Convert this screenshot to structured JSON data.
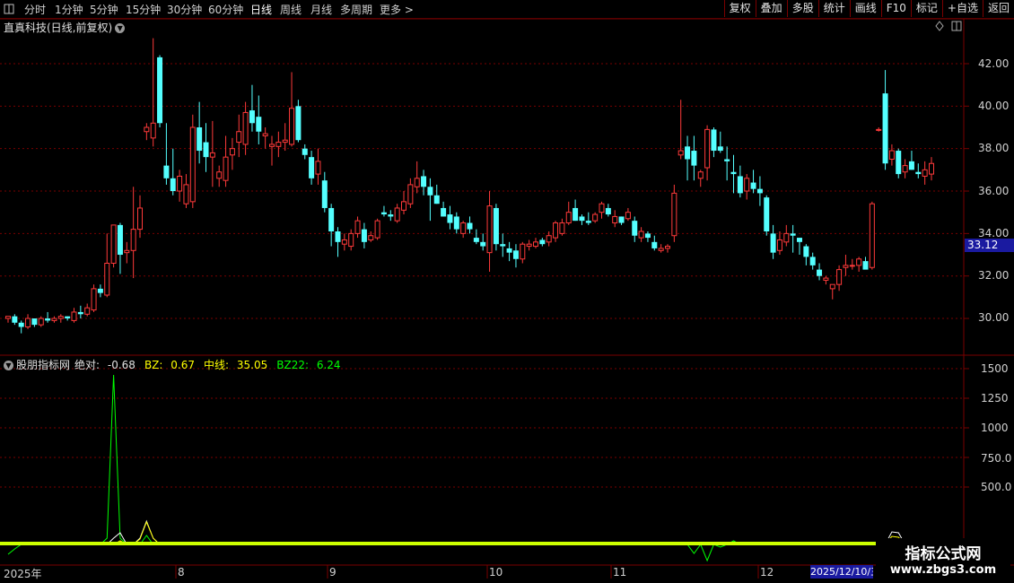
{
  "toolbar": {
    "corner_icon": "window-icon",
    "periods": [
      "分时",
      "1分钟",
      "5分钟",
      "15分钟",
      "30分钟",
      "60分钟",
      "日线",
      "周线",
      "月线",
      "多周期",
      "更多"
    ],
    "active_period": "日线",
    "right_buttons": [
      "复权",
      "叠加",
      "多股",
      "统计",
      "画线",
      "F10",
      "标记",
      "+自选",
      "返回"
    ]
  },
  "stock": {
    "title": "直真科技(日线,前复权)",
    "dropdown_icon": "chevron-down-icon"
  },
  "price_axis": {
    "labels": [
      "42.00",
      "40.00",
      "38.00",
      "36.00",
      "34.00",
      "32.00",
      "30.00"
    ],
    "current_price": "33.12"
  },
  "indicator": {
    "name": "股朋指标网",
    "abs_label": "绝对:",
    "abs_value": "-0.68",
    "bz_label": "BZ:",
    "bz_value": "0.67",
    "mid_label": "中线:",
    "mid_value": "35.05",
    "bz22_label": "BZ22:",
    "bz22_value": "6.24",
    "axis_labels": [
      "1500",
      "1250",
      "1000",
      "750.0",
      "500.0"
    ]
  },
  "time_axis": {
    "labels": [
      "2025年",
      "8",
      "9",
      "10",
      "11",
      "12"
    ],
    "selected_date": "2025/12/10/三"
  },
  "watermark": {
    "title": "指标公式网",
    "url": "www.zbgs3.com"
  },
  "colors": {
    "up": "#ff3a3a",
    "down": "#54ffff",
    "grid": "#7a0000",
    "ind_white": "#ffffff",
    "ind_yellow": "#ffff00",
    "ind_green": "#00ff00",
    "ind_lime": "#ccff00"
  },
  "chart_data": {
    "type": "candlestick",
    "y_range": [
      29,
      43.5
    ],
    "candles": [
      [
        30.0,
        30.1,
        29.8,
        30.1
      ],
      [
        30.1,
        30.2,
        29.7,
        29.8
      ],
      [
        29.8,
        29.9,
        29.3,
        29.6
      ],
      [
        29.6,
        30.2,
        29.5,
        30.0
      ],
      [
        30.0,
        30.0,
        29.6,
        29.7
      ],
      [
        29.7,
        30.1,
        29.6,
        30.0
      ],
      [
        30.0,
        30.3,
        29.8,
        29.9
      ],
      [
        29.9,
        30.1,
        29.8,
        30.0
      ],
      [
        30.0,
        30.2,
        29.8,
        30.1
      ],
      [
        30.1,
        30.1,
        29.9,
        30.0
      ],
      [
        29.9,
        30.5,
        29.8,
        30.3
      ],
      [
        30.3,
        30.6,
        30.0,
        30.2
      ],
      [
        30.2,
        30.7,
        30.1,
        30.5
      ],
      [
        30.4,
        31.6,
        30.3,
        31.4
      ],
      [
        31.4,
        31.6,
        31.0,
        31.2
      ],
      [
        31.1,
        34.0,
        31.0,
        32.6
      ],
      [
        32.6,
        33.6,
        32.4,
        34.4
      ],
      [
        34.4,
        34.5,
        32.1,
        33.0
      ],
      [
        33.1,
        33.6,
        32.6,
        33.2
      ],
      [
        33.2,
        36.2,
        31.9,
        34.2
      ],
      [
        34.2,
        35.8,
        33.8,
        35.2
      ],
      [
        38.8,
        39.2,
        38.4,
        39.0
      ],
      [
        38.5,
        43.2,
        38.1,
        39.2
      ],
      [
        42.3,
        42.4,
        39.0,
        39.2
      ],
      [
        37.2,
        39.2,
        36.3,
        36.6
      ],
      [
        36.6,
        38.0,
        35.8,
        36.0
      ],
      [
        36.0,
        37.0,
        35.5,
        36.7
      ],
      [
        35.4,
        36.8,
        35.2,
        36.3
      ],
      [
        35.5,
        39.6,
        35.2,
        39.0
      ],
      [
        39.0,
        40.2,
        37.3,
        37.9
      ],
      [
        38.3,
        39.2,
        36.9,
        37.6
      ],
      [
        37.6,
        39.3,
        36.2,
        37.8
      ],
      [
        36.6,
        37.2,
        36.2,
        36.9
      ],
      [
        36.5,
        38.6,
        36.2,
        37.6
      ],
      [
        37.7,
        38.5,
        37.0,
        38.0
      ],
      [
        38.3,
        39.6,
        37.6,
        38.8
      ],
      [
        38.2,
        40.2,
        37.7,
        39.7
      ],
      [
        39.8,
        41.0,
        38.8,
        39.2
      ],
      [
        39.5,
        40.5,
        38.2,
        38.8
      ],
      [
        38.6,
        39.0,
        38.0,
        38.7
      ],
      [
        38.1,
        38.6,
        37.2,
        38.2
      ],
      [
        38.1,
        38.8,
        37.6,
        38.3
      ],
      [
        38.3,
        39.2,
        37.9,
        38.4
      ],
      [
        38.2,
        41.6,
        38.1,
        39.9
      ],
      [
        40.0,
        40.3,
        38.3,
        38.4
      ],
      [
        38.0,
        38.2,
        37.5,
        37.7
      ],
      [
        37.6,
        37.9,
        36.3,
        36.6
      ],
      [
        36.8,
        38.0,
        36.3,
        37.4
      ],
      [
        36.5,
        36.9,
        35.0,
        35.2
      ],
      [
        35.2,
        35.4,
        33.4,
        34.1
      ],
      [
        34.1,
        34.3,
        32.9,
        33.6
      ],
      [
        33.5,
        34.0,
        33.2,
        33.7
      ],
      [
        33.4,
        34.2,
        33.2,
        34.0
      ],
      [
        34.0,
        34.8,
        33.8,
        34.6
      ],
      [
        34.2,
        34.5,
        33.3,
        33.6
      ],
      [
        33.7,
        34.1,
        33.6,
        33.9
      ],
      [
        33.8,
        34.7,
        33.7,
        34.6
      ],
      [
        35.0,
        35.3,
        34.8,
        34.9
      ],
      [
        34.9,
        35.1,
        34.6,
        34.8
      ],
      [
        34.6,
        35.4,
        34.5,
        35.2
      ],
      [
        35.1,
        36.0,
        34.9,
        35.5
      ],
      [
        35.4,
        36.6,
        35.2,
        36.3
      ],
      [
        36.2,
        37.4,
        35.9,
        36.6
      ],
      [
        36.7,
        37.0,
        35.8,
        36.2
      ],
      [
        36.2,
        36.6,
        34.6,
        35.8
      ],
      [
        35.8,
        36.3,
        35.4,
        35.4
      ],
      [
        35.2,
        35.5,
        34.8,
        34.8
      ],
      [
        34.9,
        35.3,
        34.2,
        34.5
      ],
      [
        34.8,
        35.0,
        34.0,
        34.2
      ],
      [
        34.0,
        34.6,
        33.8,
        34.5
      ],
      [
        34.5,
        34.8,
        34.0,
        34.2
      ],
      [
        33.8,
        34.2,
        33.5,
        33.6
      ],
      [
        33.6,
        34.0,
        33.2,
        33.4
      ],
      [
        33.1,
        36.0,
        32.2,
        35.3
      ],
      [
        35.2,
        35.4,
        33.2,
        33.5
      ],
      [
        33.5,
        34.0,
        32.9,
        33.4
      ],
      [
        33.3,
        33.6,
        32.7,
        33.1
      ],
      [
        33.2,
        33.5,
        32.4,
        32.8
      ],
      [
        32.8,
        33.6,
        32.6,
        33.5
      ],
      [
        33.4,
        33.7,
        33.2,
        33.5
      ],
      [
        33.4,
        33.8,
        33.3,
        33.6
      ],
      [
        33.7,
        33.8,
        33.4,
        33.5
      ],
      [
        33.6,
        34.1,
        33.4,
        33.9
      ],
      [
        33.8,
        34.6,
        33.6,
        34.5
      ],
      [
        34.0,
        34.7,
        33.9,
        34.5
      ],
      [
        34.5,
        35.5,
        34.4,
        35.0
      ],
      [
        35.2,
        35.6,
        34.6,
        34.6
      ],
      [
        34.8,
        34.9,
        34.4,
        34.6
      ],
      [
        34.6,
        35.0,
        34.4,
        34.5
      ],
      [
        34.6,
        35.0,
        34.5,
        34.9
      ],
      [
        35.0,
        35.5,
        34.7,
        35.4
      ],
      [
        35.2,
        35.4,
        34.8,
        34.9
      ],
      [
        34.5,
        35.1,
        34.3,
        34.8
      ],
      [
        34.8,
        34.8,
        34.4,
        34.5
      ],
      [
        34.7,
        35.2,
        34.6,
        35.0
      ],
      [
        34.6,
        34.8,
        33.6,
        33.9
      ],
      [
        33.8,
        34.3,
        33.6,
        34.1
      ],
      [
        34.0,
        34.1,
        33.6,
        33.8
      ],
      [
        33.6,
        33.9,
        33.2,
        33.3
      ],
      [
        33.2,
        33.5,
        33.1,
        33.3
      ],
      [
        33.3,
        33.5,
        33.1,
        33.4
      ],
      [
        33.9,
        36.3,
        33.6,
        35.9
      ],
      [
        37.7,
        40.3,
        37.5,
        37.9
      ],
      [
        38.1,
        38.6,
        36.5,
        37.5
      ],
      [
        37.9,
        38.6,
        36.5,
        37.2
      ],
      [
        36.6,
        37.0,
        36.2,
        36.9
      ],
      [
        37.1,
        39.1,
        36.5,
        38.9
      ],
      [
        38.9,
        39.0,
        37.6,
        37.9
      ],
      [
        38.1,
        38.8,
        37.8,
        37.9
      ],
      [
        37.5,
        38.1,
        36.5,
        37.4
      ],
      [
        36.9,
        37.7,
        35.9,
        36.8
      ],
      [
        36.7,
        37.2,
        35.7,
        35.9
      ],
      [
        36.0,
        36.8,
        35.6,
        36.6
      ],
      [
        36.4,
        37.0,
        35.9,
        36.1
      ],
      [
        36.1,
        36.7,
        35.3,
        35.9
      ],
      [
        35.7,
        35.8,
        33.9,
        34.1
      ],
      [
        34.0,
        34.4,
        32.8,
        33.1
      ],
      [
        33.2,
        34.1,
        33.0,
        33.7
      ],
      [
        33.6,
        34.4,
        33.4,
        34.0
      ],
      [
        34.0,
        34.4,
        33.1,
        33.9
      ],
      [
        33.8,
        33.8,
        33.0,
        33.6
      ],
      [
        33.4,
        33.5,
        32.5,
        32.9
      ],
      [
        32.9,
        33.1,
        32.3,
        32.5
      ],
      [
        32.3,
        32.6,
        31.8,
        32.0
      ],
      [
        31.8,
        32.0,
        31.6,
        31.9
      ],
      [
        31.4,
        31.6,
        30.9,
        31.6
      ],
      [
        31.6,
        32.5,
        31.3,
        32.3
      ],
      [
        32.4,
        33.0,
        32.0,
        32.5
      ],
      [
        32.5,
        32.8,
        32.3,
        32.5
      ],
      [
        32.5,
        32.9,
        32.2,
        32.8
      ],
      [
        32.7,
        32.9,
        32.4,
        32.3
      ],
      [
        32.4,
        35.5,
        32.3,
        35.4
      ],
      [
        38.9,
        39.0,
        38.8,
        38.9
      ],
      [
        40.6,
        41.7,
        37.0,
        37.3
      ],
      [
        37.5,
        38.2,
        37.2,
        37.9
      ],
      [
        37.9,
        38.0,
        36.6,
        36.8
      ],
      [
        36.9,
        37.5,
        36.6,
        37.2
      ],
      [
        37.4,
        37.9,
        37.0,
        37.0
      ],
      [
        36.9,
        37.3,
        36.6,
        36.8
      ],
      [
        36.7,
        37.4,
        36.3,
        37.0
      ],
      [
        36.8,
        37.6,
        36.5,
        37.3
      ]
    ],
    "indicator_range": [
      -200,
      1600
    ]
  }
}
